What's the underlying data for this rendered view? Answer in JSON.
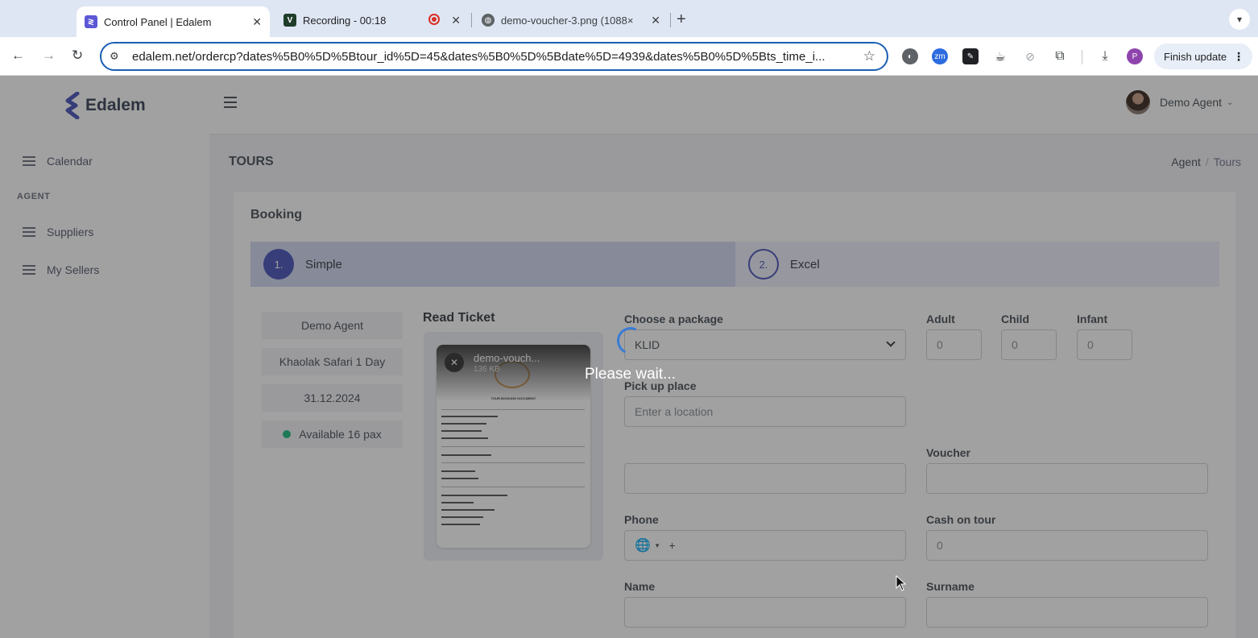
{
  "browser": {
    "tabs": [
      {
        "title": "Control Panel | Edalem",
        "icon": "edalem-favicon",
        "active": true
      },
      {
        "title": "Recording - 00:18",
        "icon": "recording-favicon",
        "active": false
      },
      {
        "title": "demo-voucher-3.png (1088×",
        "icon": "globe-icon",
        "active": false
      }
    ],
    "url": "edalem.net/ordercp?dates%5B0%5D%5Btour_id%5D=45&dates%5B0%5D%5Bdate%5D=4939&dates%5B0%5D%5Bts_time_i...",
    "finish_update": "Finish update",
    "profile_initial": "P",
    "ext_zm": "zm"
  },
  "app": {
    "brand": "Edalem",
    "user_name": "Demo Agent",
    "sidebar": {
      "calendar": "Calendar",
      "section_title": "AGENT",
      "suppliers": "Suppliers",
      "my_sellers": "My Sellers"
    },
    "page_title": "TOURS",
    "breadcrumb": {
      "parent": "Agent",
      "separator": "/",
      "current": "Tours"
    },
    "card_title": "Booking",
    "steps": [
      {
        "num": "1.",
        "label": "Simple"
      },
      {
        "num": "2.",
        "label": "Excel"
      }
    ],
    "info": {
      "agent": "Demo Agent",
      "tour": "Khaolak Safari 1 Day",
      "date": "31.12.2024",
      "availability": "Available 16 pax"
    },
    "read_ticket": {
      "title": "Read Ticket",
      "file_name": "demo-vouch...",
      "file_size": "136 KB",
      "doc_heading": "TOUR BOOKING DOCUMENT"
    },
    "form": {
      "package_label": "Choose a package",
      "package_value": "KLID",
      "adult_label": "Adult",
      "adult_value": "0",
      "child_label": "Child",
      "child_value": "0",
      "infant_label": "Infant",
      "infant_value": "0",
      "pickup_label": "Pick up place",
      "pickup_placeholder": "Enter a location",
      "voucher_label": "Voucher",
      "phone_label": "Phone",
      "phone_prefix": "+",
      "cash_label": "Cash on tour",
      "cash_value": "0",
      "name_label": "Name",
      "surname_label": "Surname"
    }
  },
  "overlay": {
    "message": "Please wait..."
  }
}
